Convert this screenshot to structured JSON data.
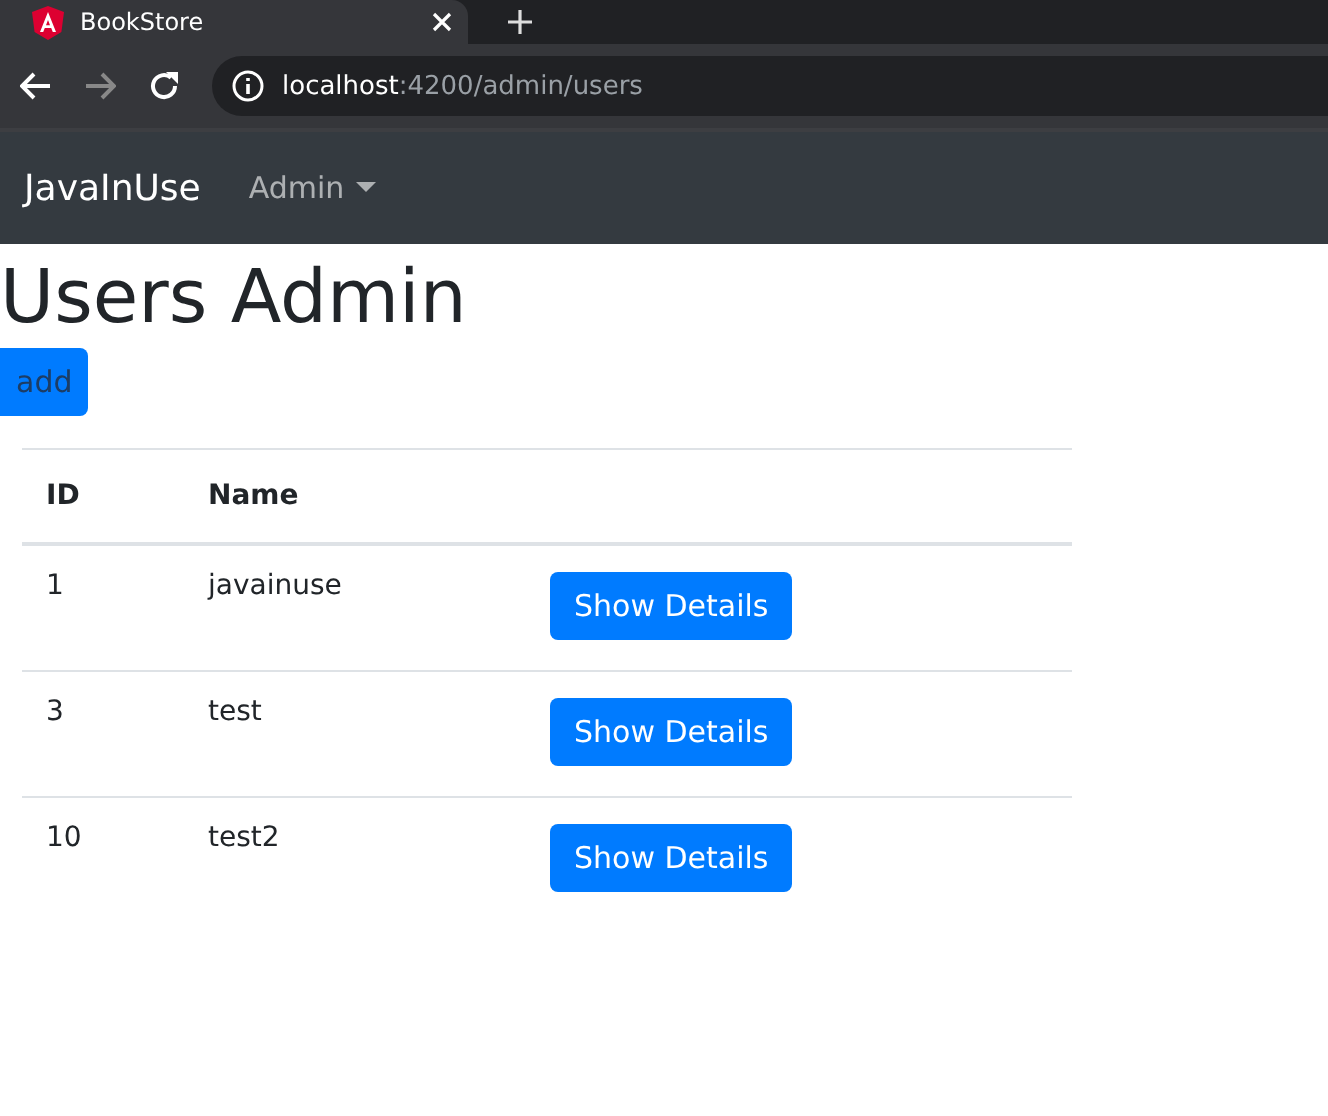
{
  "browser": {
    "tab": {
      "title": "BookStore"
    },
    "address": {
      "host": "localhost",
      "path": ":4200/admin/users"
    }
  },
  "navbar": {
    "brand": "JavaInUse",
    "menus": [
      {
        "label": "Admin"
      }
    ]
  },
  "page": {
    "title": "Users Admin",
    "add_button": "add"
  },
  "table": {
    "columns": [
      "ID",
      "Name"
    ],
    "rows": [
      {
        "id": "1",
        "name": "javainuse",
        "action": "Show Details"
      },
      {
        "id": "3",
        "name": "test",
        "action": "Show Details"
      },
      {
        "id": "10",
        "name": "test2",
        "action": "Show Details"
      }
    ]
  }
}
